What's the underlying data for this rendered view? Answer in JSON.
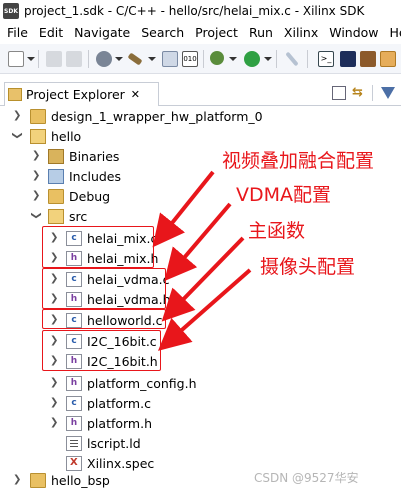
{
  "window": {
    "app_icon_text": "SDK",
    "title": "project_1.sdk - C/C++ - hello/src/helai_mix.c - Xilinx SDK"
  },
  "menubar": {
    "items": [
      "File",
      "Edit",
      "Navigate",
      "Search",
      "Project",
      "Run",
      "Xilinx",
      "Window",
      "He"
    ]
  },
  "view": {
    "tab_label": "Project Explorer",
    "close_glyph": "✕"
  },
  "tree": {
    "design_project": "design_1_wrapper_hw_platform_0",
    "hello_project": "hello",
    "binaries": "Binaries",
    "includes": "Includes",
    "debug": "Debug",
    "src": "src",
    "files": [
      {
        "name": "helai_mix.c",
        "type": "c"
      },
      {
        "name": "helai_mix.h",
        "type": "h"
      },
      {
        "name": "helai_vdma.c",
        "type": "c"
      },
      {
        "name": "helai_vdma.h",
        "type": "h"
      },
      {
        "name": "helloworld.c",
        "type": "c"
      },
      {
        "name": "I2C_16bit.c",
        "type": "c"
      },
      {
        "name": "I2C_16bit.h",
        "type": "h"
      },
      {
        "name": "platform_config.h",
        "type": "h"
      },
      {
        "name": "platform.c",
        "type": "c"
      },
      {
        "name": "platform.h",
        "type": "h"
      },
      {
        "name": "lscript.ld",
        "type": "ld"
      },
      {
        "name": "Xilinx.spec",
        "type": "spec"
      }
    ],
    "bsp_project": "hello_bsp"
  },
  "annotations": {
    "mix": "视频叠加融合配置",
    "vdma": "VDMA配置",
    "main": "主函数",
    "camera": "摄像头配置",
    "color": "#e8161b"
  },
  "watermark": "CSDN @9527华安"
}
